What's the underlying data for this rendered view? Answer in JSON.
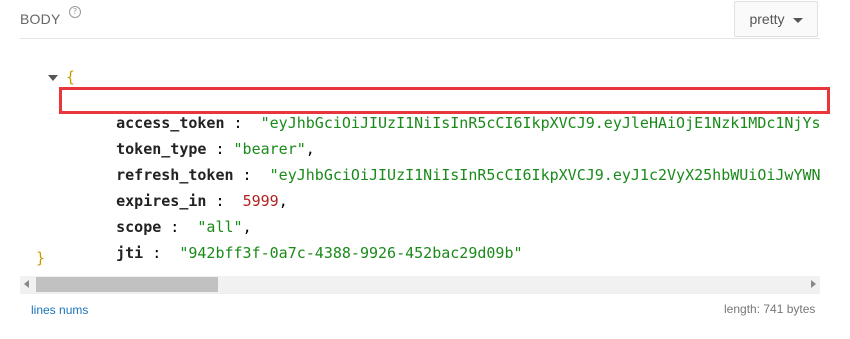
{
  "header": {
    "body_label": "BODY",
    "help_glyph": "?",
    "format_selector": "pretty"
  },
  "json_view": {
    "open_brace": "{",
    "close_brace": "}",
    "fields": [
      {
        "key": "access_token",
        "value": "\"eyJhbGciOiJIUzI1NiIsInR5cCI6IkpXVCJ9.eyJleHAiOjE1Nzk1MDc1NjYs",
        "type": "string",
        "highlighted": true
      },
      {
        "key": "token_type",
        "value": "\"bearer\"",
        "type": "string",
        "suffix": ","
      },
      {
        "key": "refresh_token",
        "value": "\"eyJhbGciOiJIUzI1NiIsInR5cCI6IkpXVCJ9.eyJ1c2VyX25hbWUiOiJwYWN",
        "type": "string"
      },
      {
        "key": "expires_in",
        "value": "5999",
        "type": "number",
        "suffix": ","
      },
      {
        "key": "scope",
        "value": "\"all\"",
        "type": "string",
        "suffix": ","
      },
      {
        "key": "jti",
        "value": "\"942bff3f-0a7c-4388-9926-452bac29d09b\"",
        "type": "string"
      }
    ],
    "separator": " : "
  },
  "footer": {
    "lines_nums": "lines nums",
    "length_text": "length: 741 bytes"
  },
  "colors": {
    "highlight_border": "#e8363b",
    "string": "#1a8a1a",
    "number": "#b22222",
    "brace": "#c99a00",
    "link": "#1b73ba"
  }
}
